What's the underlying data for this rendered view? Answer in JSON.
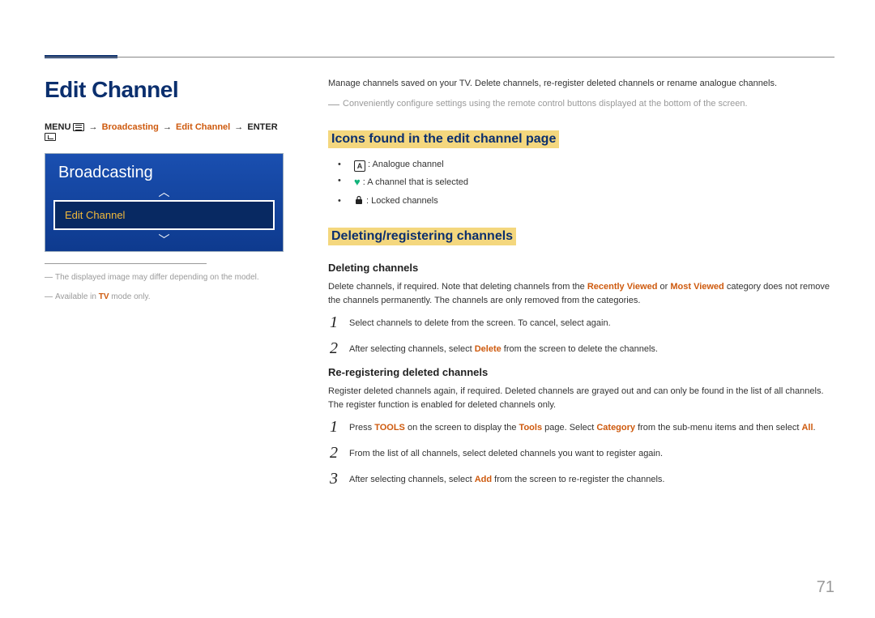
{
  "page_number": "71",
  "left": {
    "title": "Edit Channel",
    "path": {
      "menu": "MENU",
      "a1": "→",
      "broadcasting": "Broadcasting",
      "a2": "→",
      "edit_channel": "Edit Channel",
      "a3": "→",
      "enter": "ENTER"
    },
    "tv": {
      "title": "Broadcasting",
      "item": "Edit Channel"
    },
    "note1_pre": "The displayed image may differ depending on the model.",
    "note2_pre": "Available in ",
    "note2_kw": "TV",
    "note2_post": " mode only."
  },
  "right": {
    "intro": "Manage channels saved on your TV. Delete channels, re-register deleted channels or rename analogue channels.",
    "subnote": "Conveniently configure settings using the remote control buttons displayed at the bottom of the screen.",
    "h_icons": "Icons found in the edit channel page",
    "icon_items": {
      "analogue_label": "A",
      "analogue": " : Analogue channel",
      "selected": " : A channel that is selected",
      "locked": " : Locked channels"
    },
    "h_delreg": "Deleting/registering channels",
    "h_del": "Deleting channels",
    "del_para_a": "Delete channels, if required. Note that deleting channels from the ",
    "del_kw1": "Recently Viewed",
    "del_mid": " or ",
    "del_kw2": "Most Viewed",
    "del_para_b": " category does not remove the channels permanently. The channels are only removed from the categories.",
    "del_steps": {
      "n1": "1",
      "s1": "Select channels to delete from the screen. To cancel, select again.",
      "n2": "2",
      "s2_a": "After selecting channels, select ",
      "s2_kw": "Delete",
      "s2_b": " from the screen to delete the channels."
    },
    "h_rereg": "Re-registering deleted channels",
    "rereg_para": "Register deleted channels again, if required. Deleted channels are grayed out and can only be found in the list of all channels. The register function is enabled for deleted channels only.",
    "rereg_steps": {
      "n1": "1",
      "s1_a": "Press ",
      "s1_kw1": "TOOLS",
      "s1_b": " on the screen to display the ",
      "s1_kw2": "Tools",
      "s1_c": " page. Select ",
      "s1_kw3": "Category",
      "s1_d": " from the sub-menu items and then select ",
      "s1_kw4": "All",
      "s1_e": ".",
      "n2": "2",
      "s2": "From the list of all channels, select deleted channels you want to register again.",
      "n3": "3",
      "s3_a": "After selecting channels, select ",
      "s3_kw": "Add",
      "s3_b": " from the screen to re-register the channels."
    }
  }
}
